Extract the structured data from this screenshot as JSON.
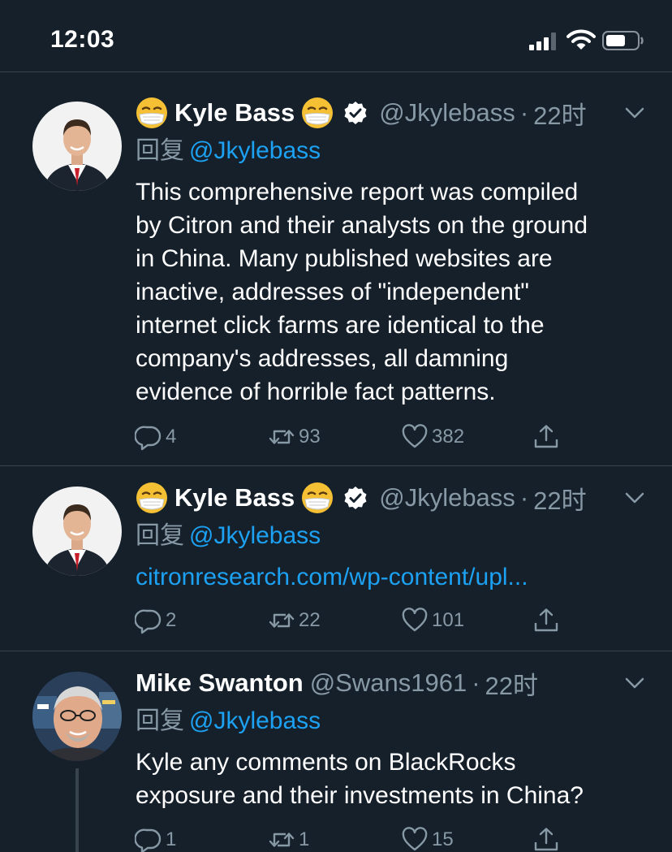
{
  "status_bar": {
    "time": "12:03"
  },
  "colors": {
    "background": "#15202b",
    "link": "#1da1f2",
    "muted": "#8899a6",
    "divider": "#38444d"
  },
  "tweets": [
    {
      "display_name": "Kyle Bass",
      "handle": "@Jkylebass",
      "separator": "·",
      "time": "22时",
      "reply_label": "回复",
      "reply_handle": "@Jkylebass",
      "text": "This comprehensive report was compiled\nby Citron and their analysts on the ground\nin China. Many published websites are\ninactive, addresses of \"independent\"\ninternet click farms are identical to the\ncompany's addresses, all damning\nevidence of horrible fact patterns.",
      "replies": "4",
      "retweets": "93",
      "likes": "382"
    },
    {
      "display_name": "Kyle Bass",
      "handle": "@Jkylebass",
      "separator": "·",
      "time": "22时",
      "reply_label": "回复",
      "reply_handle": "@Jkylebass",
      "link": "citronresearch.com/wp-content/upl...",
      "replies": "2",
      "retweets": "22",
      "likes": "101"
    },
    {
      "display_name": "Mike Swanton",
      "handle": "@Swans1961",
      "separator": "·",
      "time": "22时",
      "reply_label": "回复",
      "reply_handle": "@Jkylebass",
      "text": "Kyle any comments on BlackRocks\nexposure and their investments in China?",
      "replies": "1",
      "retweets": "1",
      "likes": "15"
    }
  ]
}
